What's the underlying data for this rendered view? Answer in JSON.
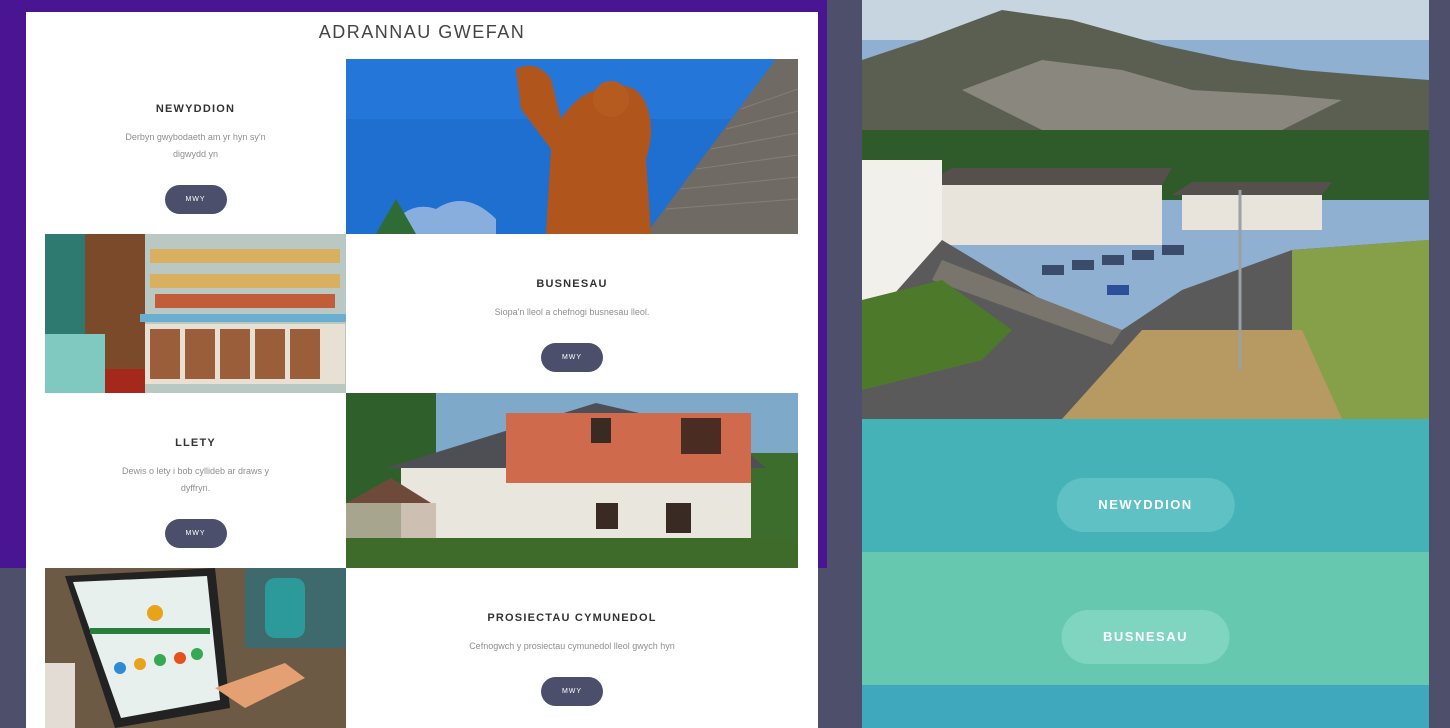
{
  "section_heading": "ADRANNAU GWEFAN",
  "cards": [
    {
      "title": "NEWYDDION",
      "desc": "Derbyn gwybodaeth am yr hyn sy'n digwydd yn",
      "button": "MWY"
    },
    {
      "title": "BUSNESAU",
      "desc": "Siopa'n lleol a chefnogi busnesau lleol.",
      "button": "MWY"
    },
    {
      "title": "LLETY",
      "desc": "Dewis o lety i bob cyllideb ar draws y dyffryn.",
      "button": "MWY"
    },
    {
      "title": "PROSIECTAU CYMUNEDOL",
      "desc": "Cefnogwch y prosiectau cymunedol lleol gwych hyn",
      "button": "MWY"
    }
  ],
  "right_buttons": [
    {
      "label": "NEWYDDION"
    },
    {
      "label": "BUSNESAU"
    }
  ],
  "colors": {
    "frame_purple": "#4a1592",
    "background_slate": "#4e4f6b",
    "button_slate": "#4c4f6b",
    "teal_1": "#45b2b7",
    "teal_2": "#66c8ae",
    "teal_3": "#3fa8bd"
  }
}
